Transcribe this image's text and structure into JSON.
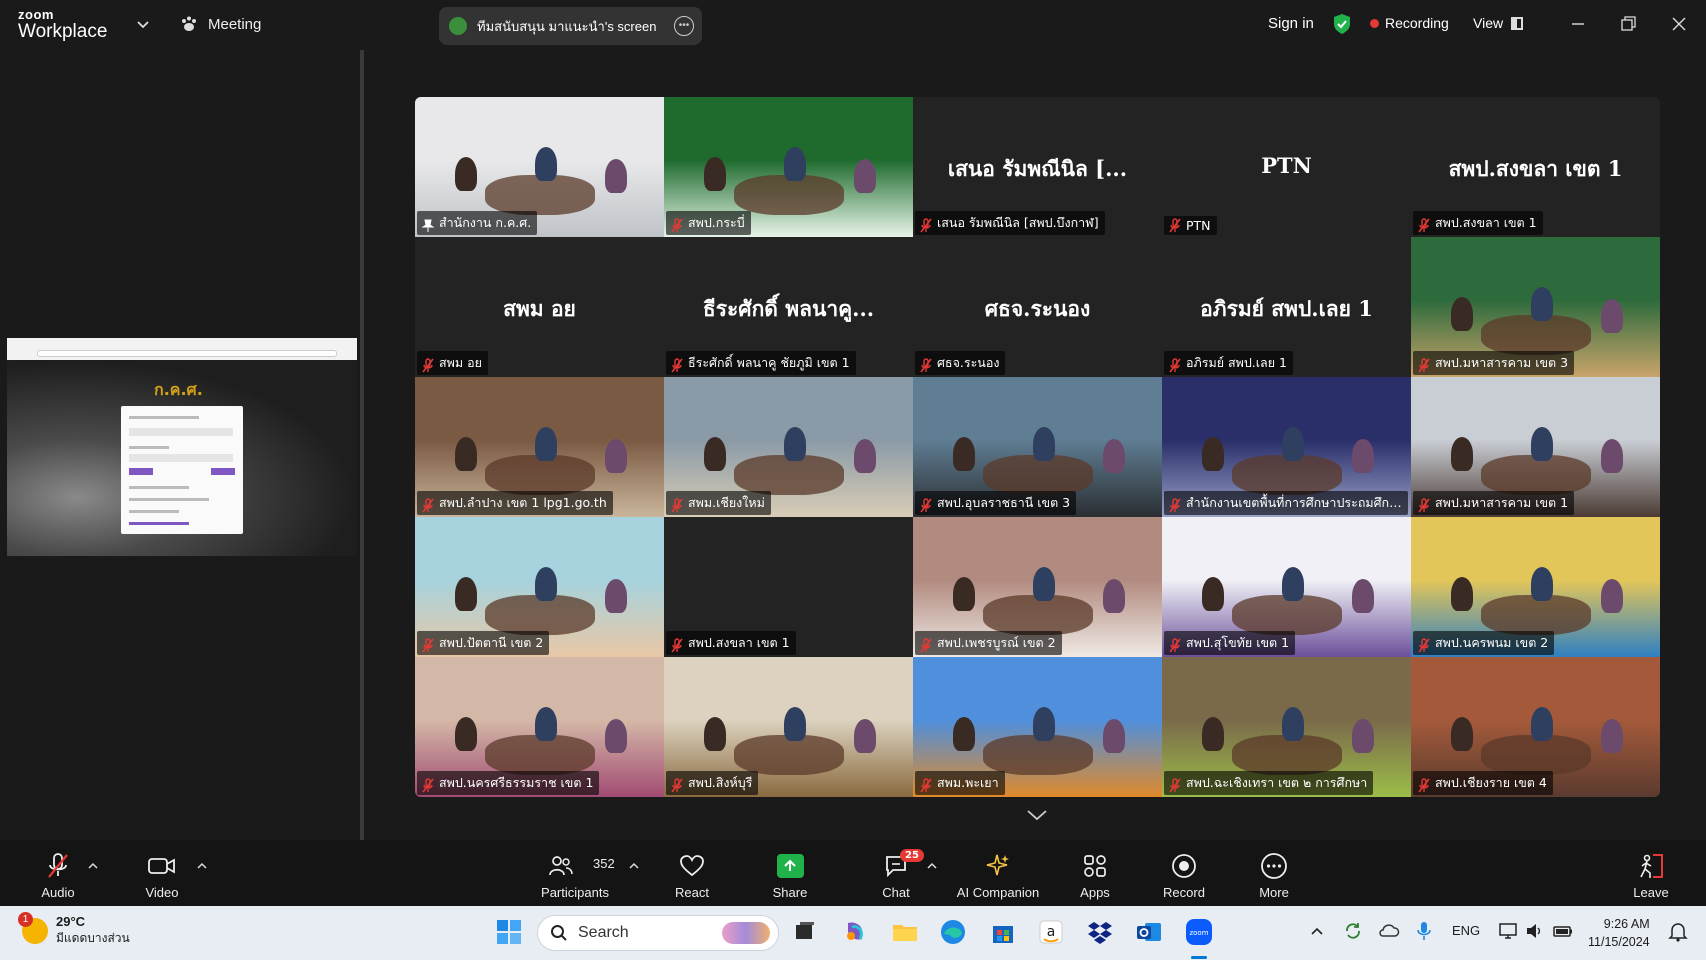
{
  "titlebar": {
    "brand_top": "zoom",
    "brand_bottom": "Workplace",
    "meeting_label": "Meeting",
    "share_indicator": "ทีมสนับสนุน มาแนะนำ's screen",
    "sign_in": "Sign in",
    "recording": "Recording",
    "view": "View"
  },
  "gallery": {
    "tiles": [
      {
        "label": "สำนักงาน ก.ค.ศ.",
        "big": "",
        "video": true,
        "active": true
      },
      {
        "label": "สพป.กระบี่",
        "big": "",
        "video": true
      },
      {
        "label": "เสนอ  รัมพณีนิล [สพป.บึงกาฬ]",
        "big": "เสนอ  รัมพณีนิล [...",
        "video": false
      },
      {
        "label": "PTN",
        "big": "PTN",
        "video": false
      },
      {
        "label": "สพป.สงขลา เขต 1",
        "big": "สพป.สงขลา เขต 1",
        "video": false
      },
      {
        "label": "สพม อย",
        "big": "สพม อย",
        "video": false
      },
      {
        "label": "ธีระศักดิ์ พลนาคู ชัยภูมิ เขต 1",
        "big": "ธีระศักดิ์ พลนาคู...",
        "video": false
      },
      {
        "label": "ศธจ.ระนอง",
        "big": "ศธจ.ระนอง",
        "video": false
      },
      {
        "label": "อภิรมย์ สพป.เลย 1",
        "big": "อภิรมย์ สพป.เลย 1",
        "video": false
      },
      {
        "label": "สพป.มหาสารคาม เขต 3",
        "big": "",
        "video": true
      },
      {
        "label": "สพป.ลำปาง เขต 1 lpg1.go.th",
        "big": "",
        "video": true
      },
      {
        "label": "สพม.เชียงใหม่",
        "big": "",
        "video": true
      },
      {
        "label": "สพป.อุบลราชธานี เขต 3",
        "big": "",
        "video": true
      },
      {
        "label": "สำนักงานเขตพื้นที่การศึกษาประถมศึกษ...",
        "big": "",
        "video": true
      },
      {
        "label": "สพป.มหาสารคาม เขต 1",
        "big": "",
        "video": true
      },
      {
        "label": "สพป.ปัตตานี เขต 2",
        "big": "",
        "video": true
      },
      {
        "label": "สพป.สงขลา เขต 1",
        "big": "",
        "video": false
      },
      {
        "label": "สพป.เพชรบูรณ์ เขต 2",
        "big": "",
        "video": true
      },
      {
        "label": "สพป.สุโขทัย เขต 1",
        "big": "",
        "video": true
      },
      {
        "label": "สพป.นครพนม เขต 2",
        "big": "",
        "video": true
      },
      {
        "label": "สพป.นครศรีธรรมราช เขต 1",
        "big": "",
        "video": true
      },
      {
        "label": "สพป.สิงห์บุรี",
        "big": "",
        "video": true
      },
      {
        "label": "สพม.พะเยา",
        "big": "",
        "video": true
      },
      {
        "label": "สพป.ฉะเชิงเทรา เขต ๒ การศึกษา",
        "big": "",
        "video": true
      },
      {
        "label": "สพป.เชียงราย เขต 4",
        "big": "",
        "video": true
      }
    ]
  },
  "sidebar": {
    "logo_text": "ก.ค.ศ."
  },
  "toolbar": {
    "audio": "Audio",
    "video": "Video",
    "participants": "Participants",
    "participants_count": "352",
    "react": "React",
    "share": "Share",
    "chat": "Chat",
    "chat_badge": "25",
    "ai_companion": "AI Companion",
    "apps": "Apps",
    "record": "Record",
    "more": "More",
    "leave": "Leave"
  },
  "taskbar": {
    "weather_temp": "29°C",
    "weather_desc": "มีแดดบางส่วน",
    "weather_badge": "1",
    "search_placeholder": "Search",
    "lang": "ENG",
    "time": "9:26 AM",
    "date": "11/15/2024"
  },
  "colors": {
    "active_speaker": "#2ecc71",
    "share_green": "#21b24c",
    "badge_red": "#e53935",
    "muted_red": "#e53935"
  }
}
